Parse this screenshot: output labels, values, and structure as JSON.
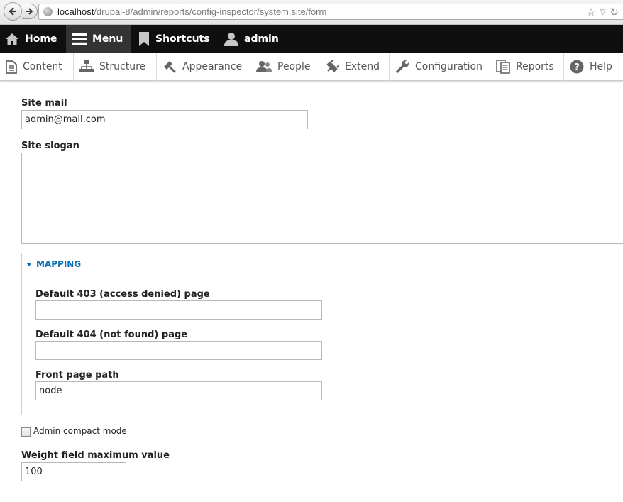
{
  "browser": {
    "url_host": "localhost",
    "url_path": "/drupal-8/admin/reports/config-inspector/system.site/form"
  },
  "toolbar": {
    "home": "Home",
    "menu": "Menu",
    "shortcuts": "Shortcuts",
    "user": "admin"
  },
  "tray": {
    "items": [
      {
        "label": "Content",
        "icon": "content-icon"
      },
      {
        "label": "Structure",
        "icon": "structure-icon"
      },
      {
        "label": "Appearance",
        "icon": "appearance-icon"
      },
      {
        "label": "People",
        "icon": "people-icon"
      },
      {
        "label": "Extend",
        "icon": "extend-icon"
      },
      {
        "label": "Configuration",
        "icon": "configuration-icon"
      },
      {
        "label": "Reports",
        "icon": "reports-icon"
      },
      {
        "label": "Help",
        "icon": "help-icon"
      }
    ]
  },
  "form": {
    "site_mail_label": "Site mail",
    "site_mail_value": "admin@mail.com",
    "site_slogan_label": "Site slogan",
    "site_slogan_value": "",
    "mapping_legend": "MAPPING",
    "default_403_label": "Default 403 (access denied) page",
    "default_403_value": "",
    "default_404_label": "Default 404 (not found) page",
    "default_404_value": "",
    "front_page_label": "Front page path",
    "front_page_value": "node",
    "admin_compact_label": "Admin compact mode",
    "admin_compact_checked": false,
    "weight_label": "Weight field maximum value",
    "weight_value": "100"
  },
  "colors": {
    "toolbar_bg": "#0f0f0f",
    "legend": "#0a6fb5"
  }
}
